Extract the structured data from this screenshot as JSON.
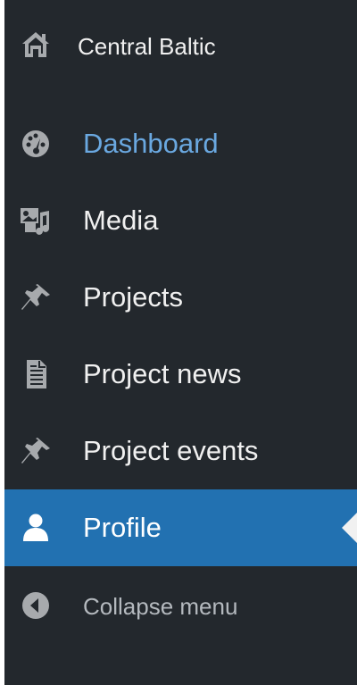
{
  "site": {
    "name": "Central Baltic",
    "icon": "home-icon"
  },
  "menu": [
    {
      "label": "Dashboard",
      "icon": "dashboard-gauge-icon",
      "state": "hover"
    },
    {
      "label": "Media",
      "icon": "media-icon",
      "state": "normal"
    },
    {
      "label": "Projects",
      "icon": "pushpin-icon",
      "state": "normal"
    },
    {
      "label": "Project news",
      "icon": "document-icon",
      "state": "normal"
    },
    {
      "label": "Project events",
      "icon": "pushpin-icon",
      "state": "normal"
    },
    {
      "label": "Profile",
      "icon": "user-icon",
      "state": "active"
    }
  ],
  "collapse": {
    "label": "Collapse menu",
    "icon": "collapse-arrow-icon"
  },
  "colors": {
    "sidebar_bg": "#23282d",
    "active_bg": "#2271b1",
    "hover_text": "#6aa8e0",
    "text": "#f0f0f0",
    "muted_text": "#b4b9be",
    "icon": "#a7aaad"
  }
}
